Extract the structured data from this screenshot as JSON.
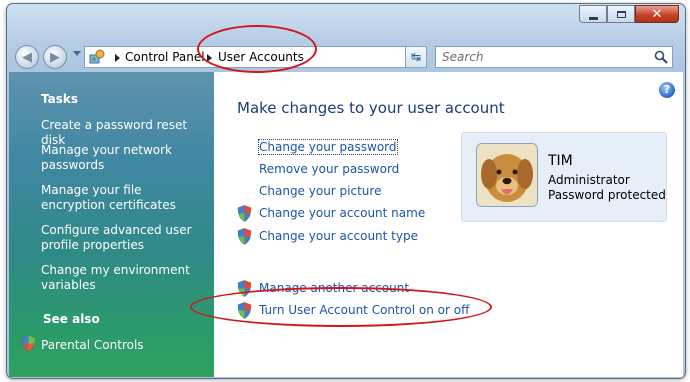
{
  "window": {
    "background_text_1": "...",
    "background_text_2": "..."
  },
  "breadcrumb": {
    "items": [
      "Control Panel",
      "User Accounts"
    ]
  },
  "search": {
    "placeholder": "Search"
  },
  "sidebar": {
    "tasks_heading": "Tasks",
    "tasks": [
      "Create a password reset disk",
      "Manage your network passwords",
      "Manage your file encryption certificates",
      "Configure advanced user profile properties",
      "Change my environment variables"
    ],
    "see_also_heading": "See also",
    "see_also": [
      "Parental Controls"
    ]
  },
  "main": {
    "title": "Make changes to your user account",
    "tasks": [
      "Change your password",
      "Remove your password",
      "Change your picture",
      "Change your account name",
      "Change your account type"
    ],
    "other_tasks": [
      "Manage another account",
      "Turn User Account Control on or off"
    ]
  },
  "account": {
    "name": "TIM",
    "type": "Administrator",
    "status": "Password protected"
  },
  "icons": {
    "shield": "uac-shield-icon",
    "help": "help-icon",
    "search": "search-icon",
    "refresh": "refresh-icon",
    "control_panel": "control-panel-icon"
  },
  "colors": {
    "link": "#1b56a8",
    "annotation": "#d0181c"
  }
}
